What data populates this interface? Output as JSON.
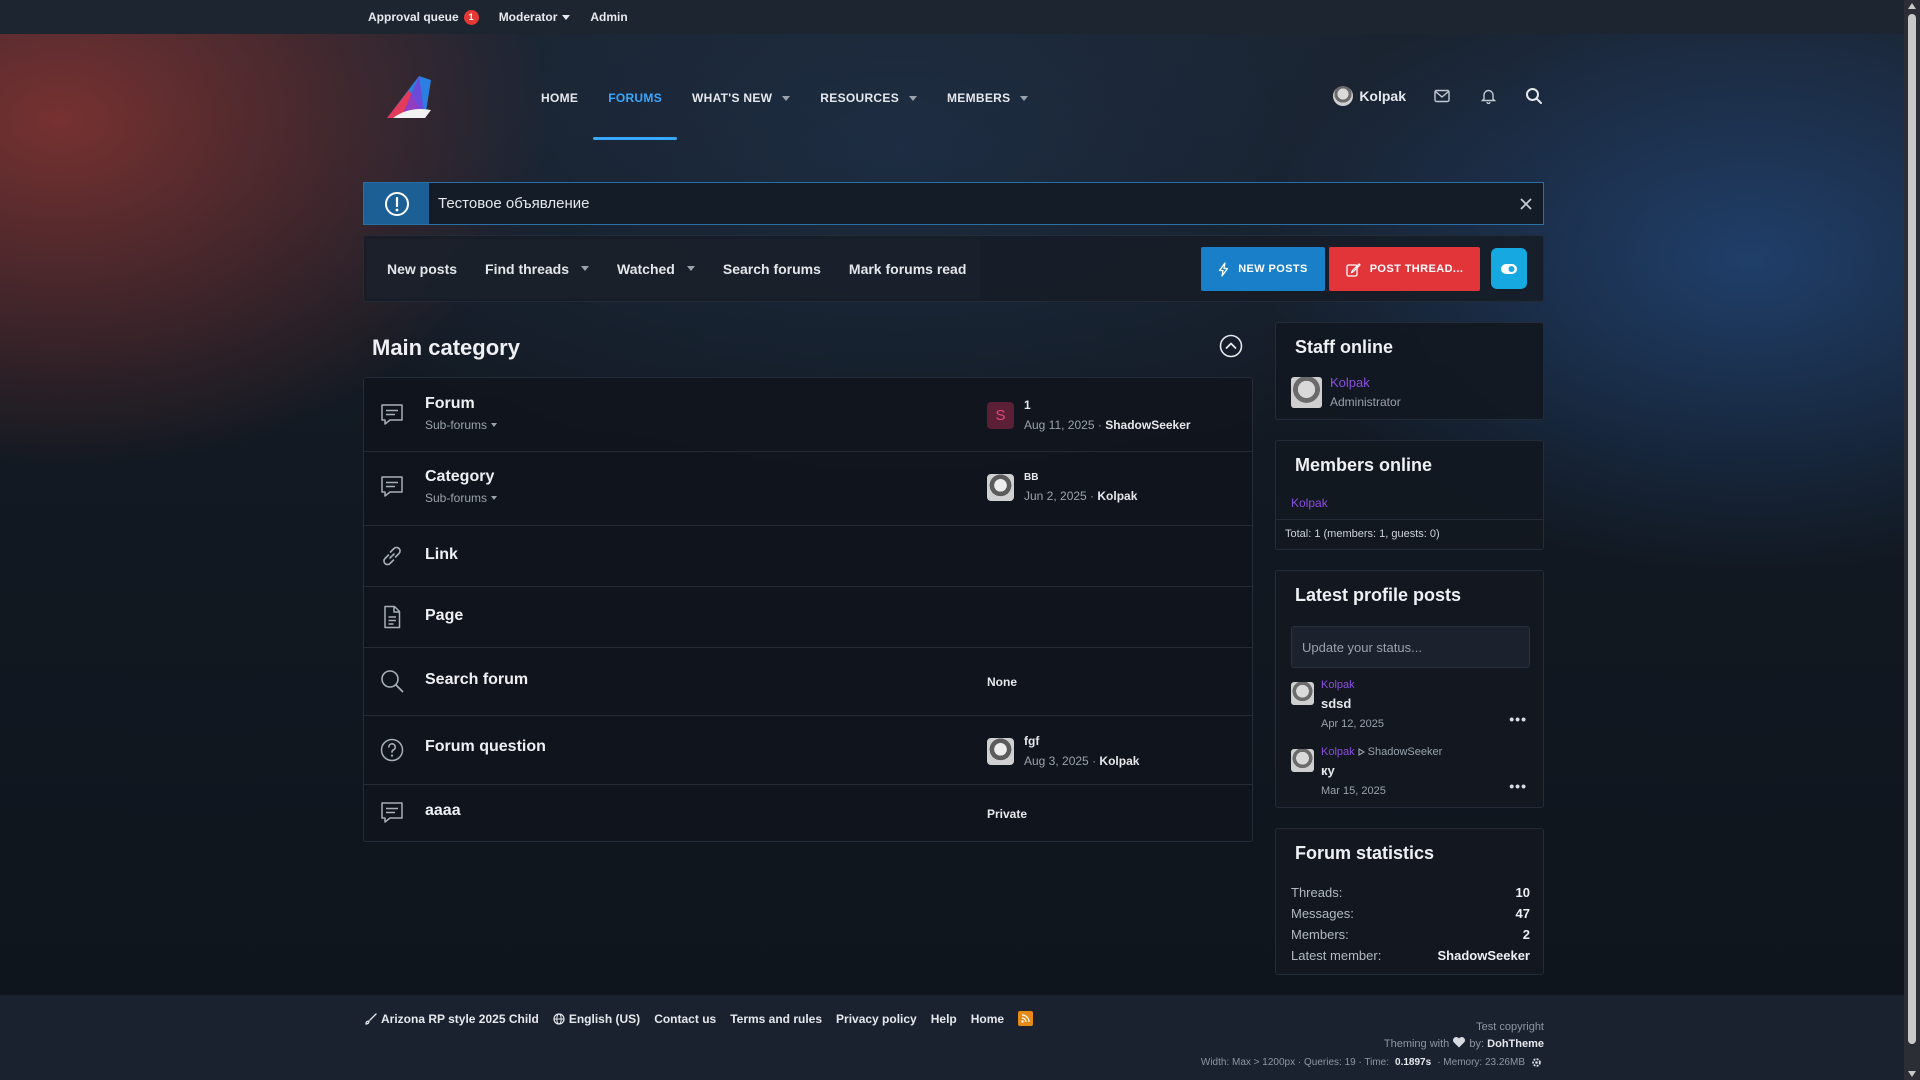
{
  "topbar": {
    "approval_label": "Approval queue",
    "approval_count": "1",
    "moderator_label": "Moderator",
    "admin_label": "Admin"
  },
  "nav": {
    "tabs": [
      {
        "label": "HOME",
        "active": false,
        "dropdown": false
      },
      {
        "label": "FORUMS",
        "active": true,
        "dropdown": false
      },
      {
        "label": "WHAT'S NEW",
        "active": false,
        "dropdown": true
      },
      {
        "label": "RESOURCES",
        "active": false,
        "dropdown": true
      },
      {
        "label": "MEMBERS",
        "active": false,
        "dropdown": true
      }
    ],
    "username": "Kolpak"
  },
  "notice": {
    "text": "Тестовое объявление"
  },
  "subnav": {
    "items": [
      {
        "label": "New posts",
        "dropdown": false
      },
      {
        "label": "Find threads",
        "dropdown": true
      },
      {
        "label": "Watched",
        "dropdown": true
      },
      {
        "label": "Search forums",
        "dropdown": false
      },
      {
        "label": "Mark forums read",
        "dropdown": false
      }
    ],
    "new_posts_button": "NEW POSTS",
    "post_thread_button": "POST THREAD..."
  },
  "main": {
    "category_title": "Main category",
    "nodes": [
      {
        "title": "Forum",
        "sub": "Sub-forums",
        "icon": "forum-icon",
        "last_title": "1",
        "last_date": "Aug 11, 2025",
        "last_user": "ShadowSeeker",
        "avatar": "S"
      },
      {
        "title": "Category",
        "sub": "Sub-forums",
        "icon": "forum-icon",
        "last_title": "BB",
        "last_date": "Jun 2, 2025",
        "last_user": "Kolpak",
        "avatar": ""
      },
      {
        "title": "Link",
        "icon": "link-icon"
      },
      {
        "title": "Page",
        "icon": "page-icon"
      },
      {
        "title": "Search forum",
        "icon": "search-forum-icon",
        "plain": "None"
      },
      {
        "title": "Forum question",
        "icon": "question-icon",
        "last_title": "fgf",
        "last_date": "Aug 3, 2025",
        "last_user": "Kolpak",
        "avatar": ""
      },
      {
        "title": "aaaa",
        "icon": "forum-icon",
        "plain": "Private"
      }
    ]
  },
  "sidebar": {
    "staff": {
      "title": "Staff online",
      "name": "Kolpak",
      "role": "Administrator"
    },
    "members": {
      "title": "Members online",
      "name": "Kolpak",
      "total": "Total: 1 (members: 1, guests: 0)"
    },
    "profile_posts": {
      "title": "Latest profile posts",
      "placeholder": "Update your status...",
      "posts": [
        {
          "author": "Kolpak",
          "target": "",
          "text": "sdsd",
          "date": "Apr 12, 2025"
        },
        {
          "author": "Kolpak",
          "target": "ShadowSeeker",
          "text": "ку",
          "date": "Mar 15, 2025"
        }
      ]
    },
    "stats": {
      "title": "Forum statistics",
      "rows": [
        {
          "k": "Threads:",
          "v": "10"
        },
        {
          "k": "Messages:",
          "v": "47"
        },
        {
          "k": "Members:",
          "v": "2"
        },
        {
          "k": "Latest member:",
          "v": "ShadowSeeker"
        }
      ]
    }
  },
  "footer": {
    "style": "Arizona RP style 2025 Child",
    "language": "English (US)",
    "links": [
      "Contact us",
      "Terms and rules",
      "Privacy policy",
      "Help",
      "Home"
    ],
    "copyright": "Test copyright",
    "theming_prefix": "Theming with",
    "theming_by": "by:",
    "theme_author": "DohTheme",
    "debug_width": "Width: Max > 1200px · Queries: 19 · Time:",
    "debug_time": "0.1897s",
    "debug_memory": "· Memory: 23.26MB"
  },
  "colors": {
    "accent": "#3aa7ff",
    "new_posts_btn": "#1a7fc9",
    "post_thread_btn": "#e2353a",
    "staff_name": "#8b4fe0"
  }
}
